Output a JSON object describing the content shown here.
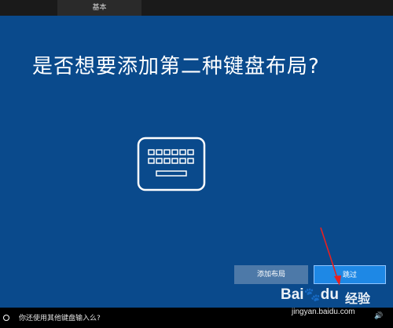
{
  "header": {
    "tab_label": "基本"
  },
  "main": {
    "title": "是否想要添加第二种键盘布局?",
    "illustration": "keyboard-icon",
    "buttons": {
      "add_label": "添加布局",
      "skip_label": "跳过"
    }
  },
  "statusbar": {
    "prompt": "你还使用其他键盘输入么?",
    "mic_icon": "mic-icon",
    "volume_icon": "volume-icon"
  },
  "watermark": {
    "brand": "Bai",
    "brand2": "du",
    "jingyan": "经验",
    "url": "jingyan.baidu.com"
  },
  "colors": {
    "panel": "#0a4a8c",
    "skip_button": "#1e88e5",
    "add_button": "#4d79a8",
    "annotation_arrow": "#e82020"
  }
}
